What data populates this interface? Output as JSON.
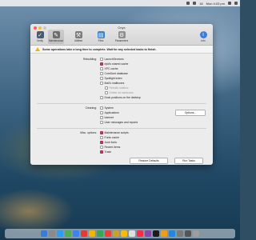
{
  "menubar": {
    "clock": "Mon 4:03 pm",
    "extra_text": "18"
  },
  "window": {
    "title": "Onyx",
    "toolbar": [
      {
        "label": "Verify",
        "icon": "check-shield-icon",
        "color": "#4a5a70"
      },
      {
        "label": "Maintenance",
        "icon": "wrench-icon",
        "color": "#6c6c6c",
        "selected": true
      },
      {
        "label": "Utilities",
        "icon": "tools-icon",
        "color": "#7d7d7d"
      },
      {
        "label": "Files",
        "icon": "files-icon",
        "color": "#3b82c6"
      },
      {
        "label": "Parameters",
        "icon": "gear-icon",
        "color": "#8e8e8e"
      },
      {
        "label": "Info",
        "icon": "info-icon",
        "color": "#3b7be0"
      }
    ],
    "warning": "Some operations take a long time to complete. Wait for any selected tasks to finish.",
    "sections": {
      "rebuilding": {
        "label": "Rebuilding:",
        "items": [
          {
            "label": "LaunchServices",
            "checked": false
          },
          {
            "label": "dyld's shared cache",
            "checked": true
          },
          {
            "label": "XPC cache",
            "checked": false
          },
          {
            "label": "CoreDuet database",
            "checked": false
          },
          {
            "label": "Spotlight index",
            "checked": false
          },
          {
            "label": "Mail's mailboxes",
            "checked": false
          },
          {
            "label": "Rebuild mailbox",
            "checked": false,
            "indent": true,
            "dim": true
          },
          {
            "label": "Delete all mailboxes",
            "checked": false,
            "indent": true,
            "dim": true
          },
          {
            "label": "Dock positions on the desktop",
            "checked": false
          }
        ]
      },
      "cleaning": {
        "label": "Cleaning:",
        "items": [
          {
            "label": "System",
            "checked": false
          },
          {
            "label": "Applications",
            "checked": false
          },
          {
            "label": "Internet",
            "checked": false
          },
          {
            "label": "User messages and reports",
            "checked": false
          }
        ],
        "browse_label": "Options..."
      },
      "misc": {
        "label": "Misc. options:",
        "items": [
          {
            "label": "Maintenance scripts",
            "checked": true
          },
          {
            "label": "Fonts cache",
            "checked": false
          },
          {
            "label": "Junk fonts",
            "checked": true
          },
          {
            "label": "Recent items",
            "checked": false
          },
          {
            "label": "Trash",
            "checked": true
          }
        ]
      }
    },
    "footer": {
      "restore_label": "Restore Defaults",
      "run_label": "Run Tasks"
    }
  },
  "colors": {
    "checkbox_on": "#c23b6b",
    "warning": "#f1b200"
  }
}
